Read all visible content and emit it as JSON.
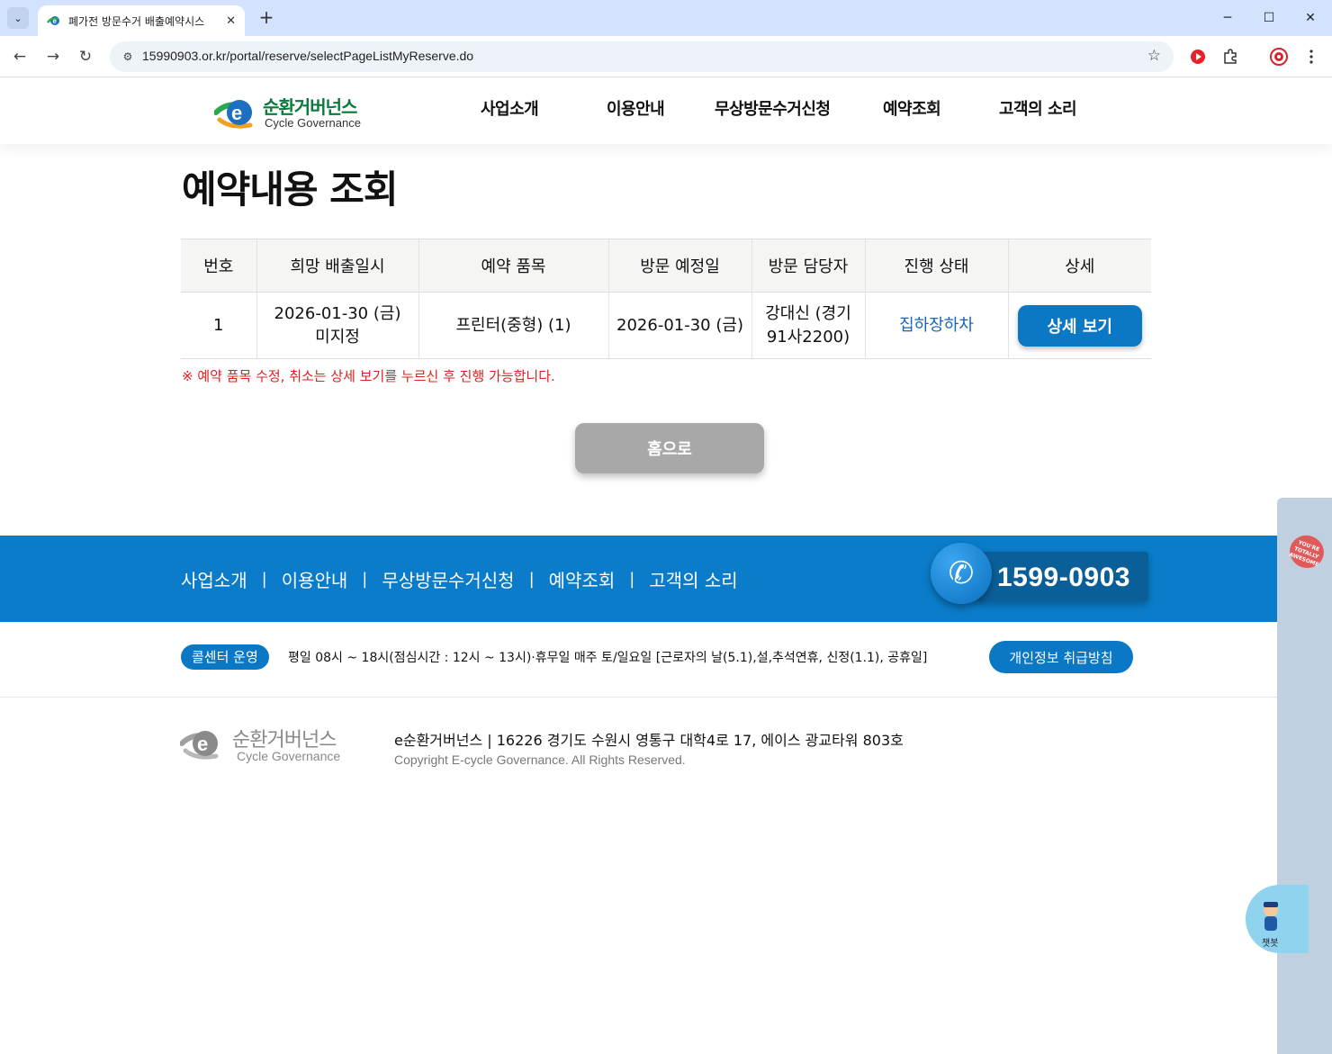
{
  "browser": {
    "tab_title": "폐가전 방문수거 배출예약시스",
    "url": "15990903.or.kr/portal/reserve/selectPageListMyReserve.do"
  },
  "header": {
    "logo_ko": "순환거버넌스",
    "logo_en": "Cycle Governance",
    "nav": [
      "사업소개",
      "이용안내",
      "무상방문수거신청",
      "예약조회",
      "고객의 소리"
    ]
  },
  "main": {
    "title": "예약내용 조회",
    "table": {
      "columns": [
        "번호",
        "희망 배출일시",
        "예약 품목",
        "방문 예정일",
        "방문 담당자",
        "진행 상태",
        "상세"
      ],
      "rows": [
        {
          "no": "1",
          "date_line1": "2026-01-30 (금)",
          "date_line2": "미지정",
          "item": "프린터(중형) (1)",
          "visit_date": "2026-01-30 (금)",
          "staff_line1": "강대신 (경기",
          "staff_line2": "91사2200)",
          "status": "집하장하차",
          "detail_label": "상세 보기"
        }
      ]
    },
    "notice": "※ 예약 품목 수정, 취소는 상세 보기를 누르신 후 진행 가능합니다.",
    "home_label": "홈으로"
  },
  "footer": {
    "nav": [
      "사업소개",
      "이용안내",
      "무상방문수거신청",
      "예약조회",
      "고객의 소리"
    ],
    "separator": "|",
    "phone": "1599-0903",
    "call_badge": "콜센터 운영",
    "hours": "평일 08시 ~ 18시(점심시간 : 12시 ~ 13시)·휴무일 매주 토/일요일   [근로자의 날(5.1),설,추석연휴, 신정(1.1), 공휴일]",
    "privacy": "개인정보 취급방침",
    "logo_ko": "순환거버넌스",
    "logo_en": "Cycle Governance",
    "address": "e순환거버넌스  | 16226 경기도 수원시 영통구 대학4로 17, 에이스 광교타워 803호",
    "copyright": "Copyright E-cycle Governance. All Rights Reserved."
  },
  "side": {
    "sticker": "YOU'RE TOTALLY AWESOME",
    "chatbot_label": "챗봇"
  },
  "colors": {
    "brand_blue": "#0b78c6",
    "footer_blue": "#0a7cc9",
    "notice_red": "#e02020",
    "status_blue": "#1565c0",
    "logo_green": "#0a7a3a"
  }
}
